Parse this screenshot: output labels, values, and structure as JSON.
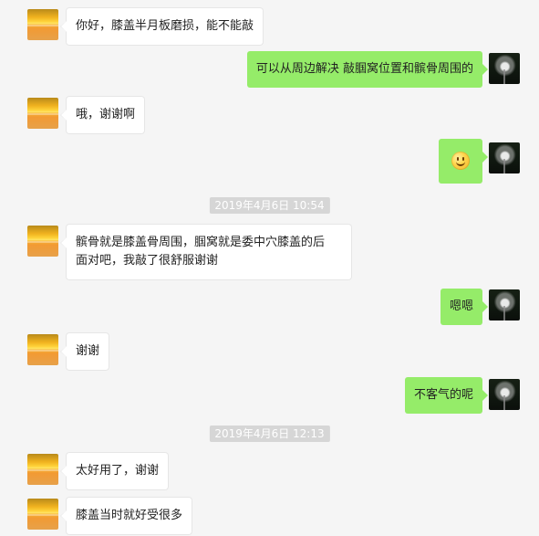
{
  "messages": [
    {
      "side": "left",
      "text": "你好，膝盖半月板磨损，能不能敲"
    },
    {
      "side": "right",
      "text": "可以从周边解决   敲腘窝位置和髌骨周围的"
    },
    {
      "side": "left",
      "text": "哦，谢谢啊"
    },
    {
      "side": "right",
      "emoji": "smile-icon"
    },
    {
      "type": "timestamp",
      "text": "2019年4月6日 10:54"
    },
    {
      "side": "left",
      "text_line1": "髌骨就是膝盖骨周围，腘窝就是委中穴膝盖的后",
      "text_line2": "面对吧，我敲了很舒服谢谢"
    },
    {
      "side": "right",
      "text": "嗯嗯"
    },
    {
      "side": "left",
      "text": "谢谢"
    },
    {
      "side": "right",
      "text": "不客气的呢"
    },
    {
      "type": "timestamp",
      "text": "2019年4月6日 12:13"
    },
    {
      "side": "left",
      "text": "太好用了，谢谢"
    },
    {
      "side": "left",
      "text": "膝盖当时就好受很多"
    }
  ],
  "colors": {
    "background": "#f5f5f5",
    "incoming_bubble": "#ffffff",
    "outgoing_bubble": "#95ec69",
    "timestamp_bg": "#d6d6d6",
    "timestamp_text": "#ffffff"
  },
  "avatars": {
    "contact": "sunset-avatar",
    "self": "plant-avatar"
  }
}
